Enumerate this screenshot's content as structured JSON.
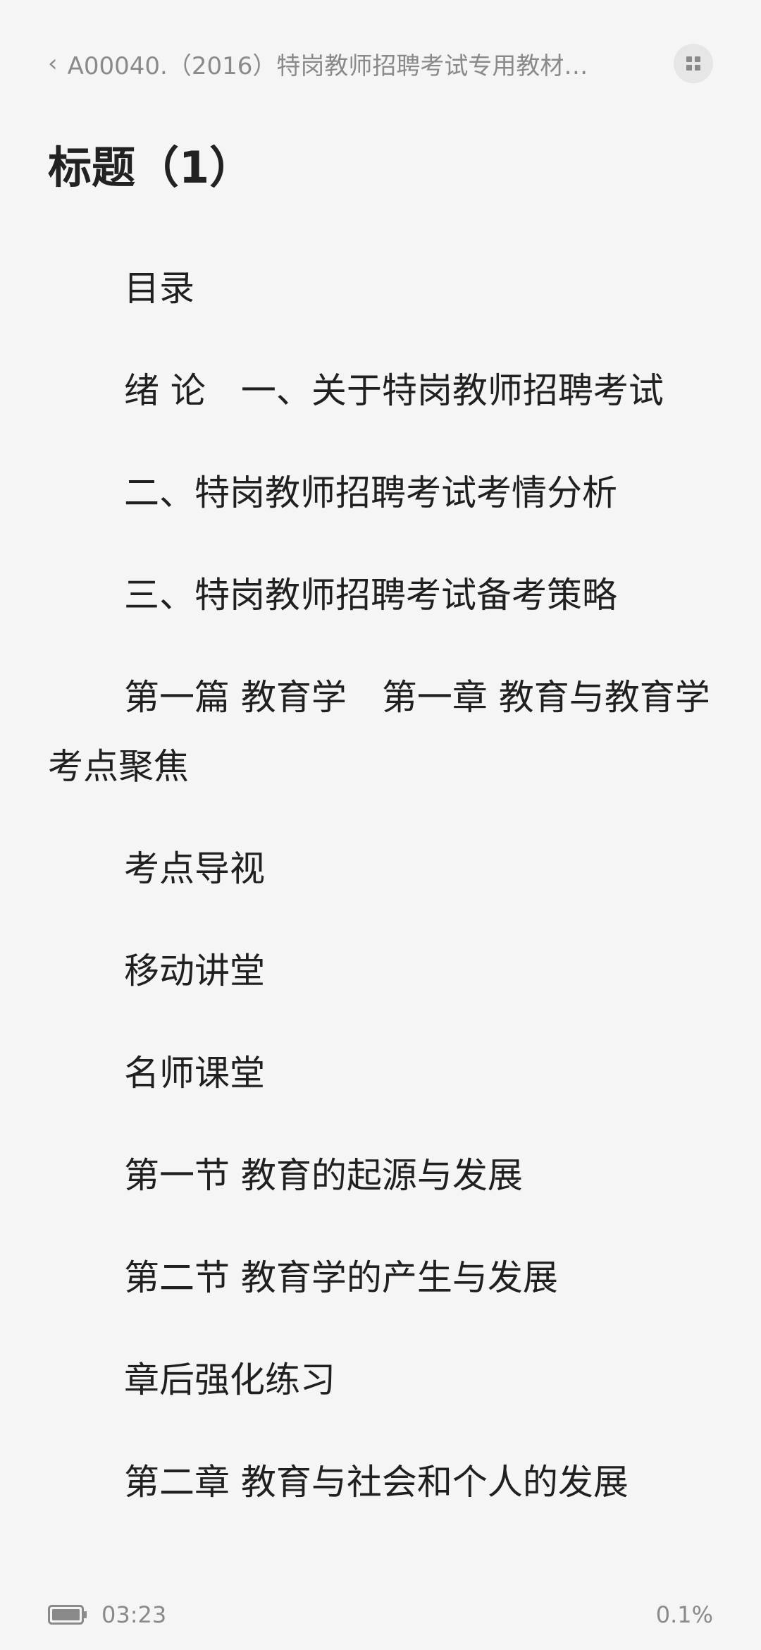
{
  "header": {
    "back_icon": "chevron-left-icon",
    "book_title": "A00040.（2016）特岗教师招聘考试专用教材…",
    "menu_icon": "grid-icon"
  },
  "chapter": {
    "title": "标题（1）"
  },
  "paragraphs": [
    "目录",
    "绪 论　一、关于特岗教师招聘考试",
    "二、特岗教师招聘考试考情分析",
    "三、特岗教师招聘考试备考策略",
    "第一篇 教育学　第一章 教育与教育学　考点聚焦",
    "考点导视",
    "移动讲堂",
    "名师课堂",
    "第一节 教育的起源与发展",
    "第二节 教育学的产生与发展",
    "章后强化练习",
    "第二章 教育与社会和个人的发展"
  ],
  "footer": {
    "battery_icon": "battery-icon",
    "time": "03:23",
    "progress": "0.1%"
  },
  "colors": {
    "background": "#f5f5f5",
    "text": "#202020",
    "muted": "#8a8a8a"
  }
}
